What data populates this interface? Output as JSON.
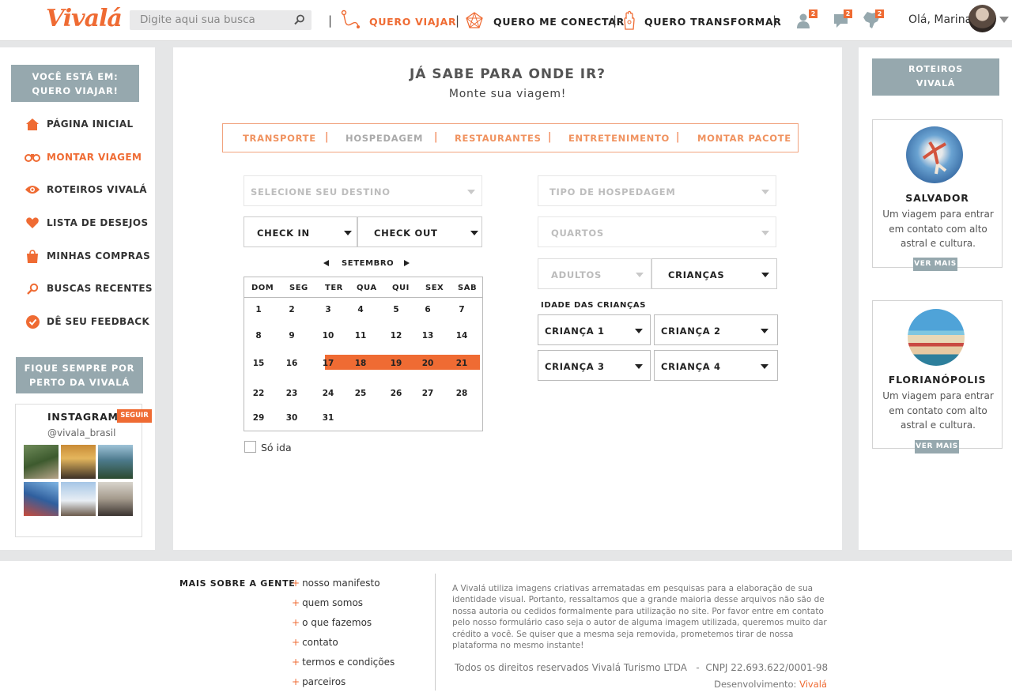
{
  "brand": {
    "logo": "Vivalá",
    "accent": "#ef6b33",
    "gray": "#96a8ae"
  },
  "header": {
    "search_placeholder": "Digite aqui sua busca",
    "nav": [
      {
        "label": "QUERO VIAJAR",
        "active": true
      },
      {
        "label": "QUERO ME CONECTAR"
      },
      {
        "label": "QUERO TRANSFORMAR"
      }
    ],
    "badges": {
      "users": "2",
      "messages": "2",
      "map": "2"
    },
    "greeting": "Olá, Marina"
  },
  "sidebar": {
    "you_are_here": "VOCÊ ESTÁ EM:",
    "current": "QUERO VIAJAR!",
    "items": [
      {
        "label": "PÁGINA INICIAL",
        "icon": "home-icon"
      },
      {
        "label": "MONTAR VIAGEM",
        "icon": "binoculars-icon",
        "active": true
      },
      {
        "label": "ROTEIROS VIVALÁ",
        "icon": "eye-icon"
      },
      {
        "label": "LISTA DE DESEJOS",
        "icon": "heart-icon"
      },
      {
        "label": "MINHAS COMPRAS",
        "icon": "bag-icon"
      },
      {
        "label": "BUSCAS RECENTES",
        "icon": "search-icon"
      },
      {
        "label": "DÊ SEU FEEDBACK",
        "icon": "check-icon"
      }
    ],
    "stay_close_1": "FIQUE SEMPRE POR",
    "stay_close_2": "PERTO DA VIVALÁ",
    "instagram": {
      "title": "INSTAGRAM",
      "follow": "SEGUIR",
      "handle": "@vivala_brasil"
    }
  },
  "main": {
    "title": "JÁ SABE PARA ONDE IR?",
    "subtitle": "Monte sua viagem!",
    "tabs": [
      "TRANSPORTE",
      "HOSPEDAGEM",
      "RESTAURANTES",
      "ENTRETENIMENTO",
      "MONTAR PACOTE"
    ],
    "destination": "SELECIONE SEU DESTINO",
    "check_in": "CHECK IN",
    "check_out": "CHECK OUT",
    "month": "SETEMBRO",
    "weekdays": [
      "DOM",
      "SEG",
      "TER",
      "QUA",
      "QUI",
      "SEX",
      "SAB"
    ],
    "weeks": [
      [
        "1",
        "2",
        "3",
        "4",
        "5",
        "6",
        "7"
      ],
      [
        "8",
        "9",
        "10",
        "11",
        "12",
        "13",
        "14"
      ],
      [
        "15",
        "16",
        "17",
        "18",
        "19",
        "20",
        "21"
      ],
      [
        "22",
        "23",
        "24",
        "25",
        "26",
        "27",
        "28"
      ],
      [
        "29",
        "30",
        "31",
        "",
        "",
        "",
        ""
      ]
    ],
    "selected_range": [
      "17",
      "21"
    ],
    "one_way": "Só ida",
    "lodging_type": "TIPO DE HOSPEDAGEM",
    "rooms": "QUARTOS",
    "adults": "ADULTOS",
    "children": "CRIANÇAS",
    "children_ages": "IDADE DAS CRIANÇAS",
    "child_fields": [
      "CRIANÇA 1",
      "CRIANÇA 2",
      "CRIANÇA 3",
      "CRIANÇA 4"
    ]
  },
  "routes": {
    "heading_1": "ROTEIROS",
    "heading_2": "VIVALÁ",
    "cards": [
      {
        "title": "SALVADOR",
        "desc": "Um viagem para entrar em contato com alto astral e cultura.",
        "cta": "VER MAIS"
      },
      {
        "title": "FLORIANÓPOLIS",
        "desc": "Um viagem para entrar em contato com alto astral e cultura.",
        "cta": "VER MAIS"
      }
    ]
  },
  "footer": {
    "heading": "MAIS SOBRE A GENTE",
    "links": [
      "nosso manifesto",
      "quem somos",
      "o que fazemos",
      "contato",
      "termos e condições",
      "parceiros"
    ],
    "disclaimer": "A Vivalá utiliza imagens criativas arrematadas em pesquisas para a elaboração de sua identidade visual. Portanto, ressaltamos que a grande maioria desse arquivos não são de nossa autoria ou cedidos formalmente para utilização no site. Por favor entre em contato pelo nosso formulário caso seja o autor de alguma imagem utilizada, queremos muito dar crédito a você. Se quiser que a mesma seja removida, prometemos tirar de nossa plataforma no mesmo instante!",
    "rights": "Todos os direitos reservados Vivalá Turismo LTDA   -  CNPJ 22.693.622/0001-98",
    "dev_label": "Desenvolvimento:",
    "dev_name": "Vivalá"
  }
}
